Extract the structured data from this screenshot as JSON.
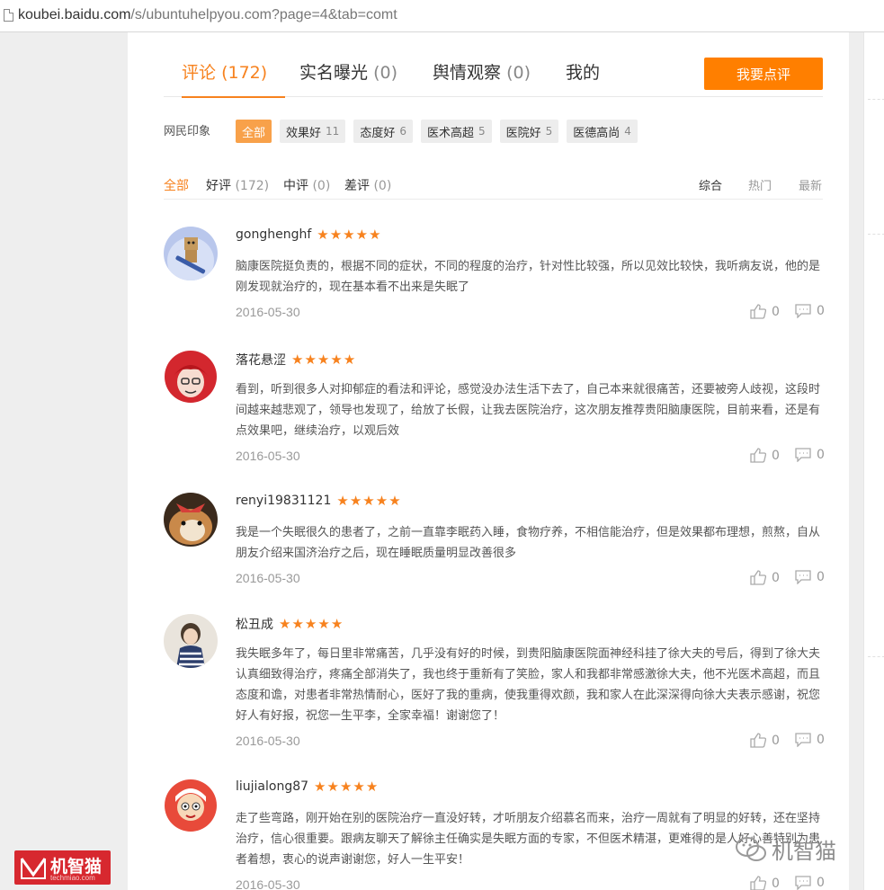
{
  "browser": {
    "url_host": "koubei.baidu.com",
    "url_path": "/s/ubuntuhelpyou.com?page=4&tab=comt"
  },
  "tabs": [
    {
      "label": "评论",
      "count": "(172)",
      "active": true
    },
    {
      "label": "实名曝光",
      "count": "(0)",
      "active": false
    },
    {
      "label": "舆情观察",
      "count": "(0)",
      "active": false
    },
    {
      "label": "我的",
      "count": "",
      "active": false
    }
  ],
  "review_button": "我要点评",
  "impressions": {
    "label": "网民印象",
    "tags": [
      {
        "label": "全部",
        "count": "",
        "active": true
      },
      {
        "label": "效果好",
        "count": "11"
      },
      {
        "label": "态度好",
        "count": "6"
      },
      {
        "label": "医术高超",
        "count": "5"
      },
      {
        "label": "医院好",
        "count": "5"
      },
      {
        "label": "医德高尚",
        "count": "4"
      }
    ]
  },
  "filters": [
    {
      "label": "全部",
      "count": "",
      "active": true
    },
    {
      "label": "好评",
      "count": "(172)"
    },
    {
      "label": "中评",
      "count": "(0)"
    },
    {
      "label": "差评",
      "count": "(0)"
    }
  ],
  "sort": [
    "综合",
    "热门",
    "最新"
  ],
  "sort_active": "综合",
  "reviews": [
    {
      "user": "gonghenghf",
      "rating": 5,
      "text": "脑康医院挺负责的，根据不同的症状，不同的程度的治疗，针对性比较强，所以见效比较快，我听病友说，他的是刚发现就治疗的，现在基本看不出来是失眠了",
      "date": "2016-05-30",
      "likes": "0",
      "comments": "0"
    },
    {
      "user": "落花悬涩",
      "rating": 5,
      "text": "看到，听到很多人对抑郁症的看法和评论，感觉没办法生活下去了，自己本来就很痛苦，还要被旁人歧视，这段时间越来越悲观了，领导也发现了，给放了长假，让我去医院治疗，这次朋友推荐贵阳脑康医院，目前来看，还是有点效果吧，继续治疗，以观后效",
      "date": "2016-05-30",
      "likes": "0",
      "comments": "0"
    },
    {
      "user": "renyi19831121",
      "rating": 5,
      "text": "我是一个失眠很久的患者了，之前一直靠李眠药入睡，食物疗养，不相信能治疗，但是效果都布理想，煎熬，自从朋友介绍来国济治疗之后，现在睡眠质量明显改善很多",
      "date": "2016-05-30",
      "likes": "0",
      "comments": "0"
    },
    {
      "user": "松丑成",
      "rating": 5,
      "text": "我失眠多年了，每日里非常痛苦，几乎没有好的时候，到贵阳脑康医院面神经科挂了徐大夫的号后，得到了徐大夫认真细致得治疗，疼痛全部消失了，我也终于重新有了笑脸，家人和我都非常感激徐大夫，他不光医术高超，而且态度和谵，对患者非常热情耐心，医好了我的重病，使我重得欢颜，我和家人在此深深得向徐大夫表示感谢，祝您好人有好报，祝您一生平李，全家幸福！谢谢您了！",
      "date": "2016-05-30",
      "likes": "0",
      "comments": "0"
    },
    {
      "user": "liujialong87",
      "rating": 5,
      "text": "走了些弯路，刚开始在别的医院治疗一直没好转，才听朋友介绍慕名而来，治疗一周就有了明显的好转，还在坚持治疗，信心很重要。跟病友聊天了解徐主任确实是失眠方面的专家，不但医术精湛，更难得的是人好心善特别为患者着想，衷心的说声谢谢您，好人一生平安！",
      "date": "2016-05-30",
      "likes": "0",
      "comments": "0"
    }
  ],
  "watermarks": {
    "logo_text": "机智猫",
    "logo_sub": "techmiao.com",
    "brand_text": "机智猫"
  },
  "colors": {
    "accent": "#f7821e",
    "button": "#ff7f00",
    "logo_bg": "#d7282f"
  }
}
